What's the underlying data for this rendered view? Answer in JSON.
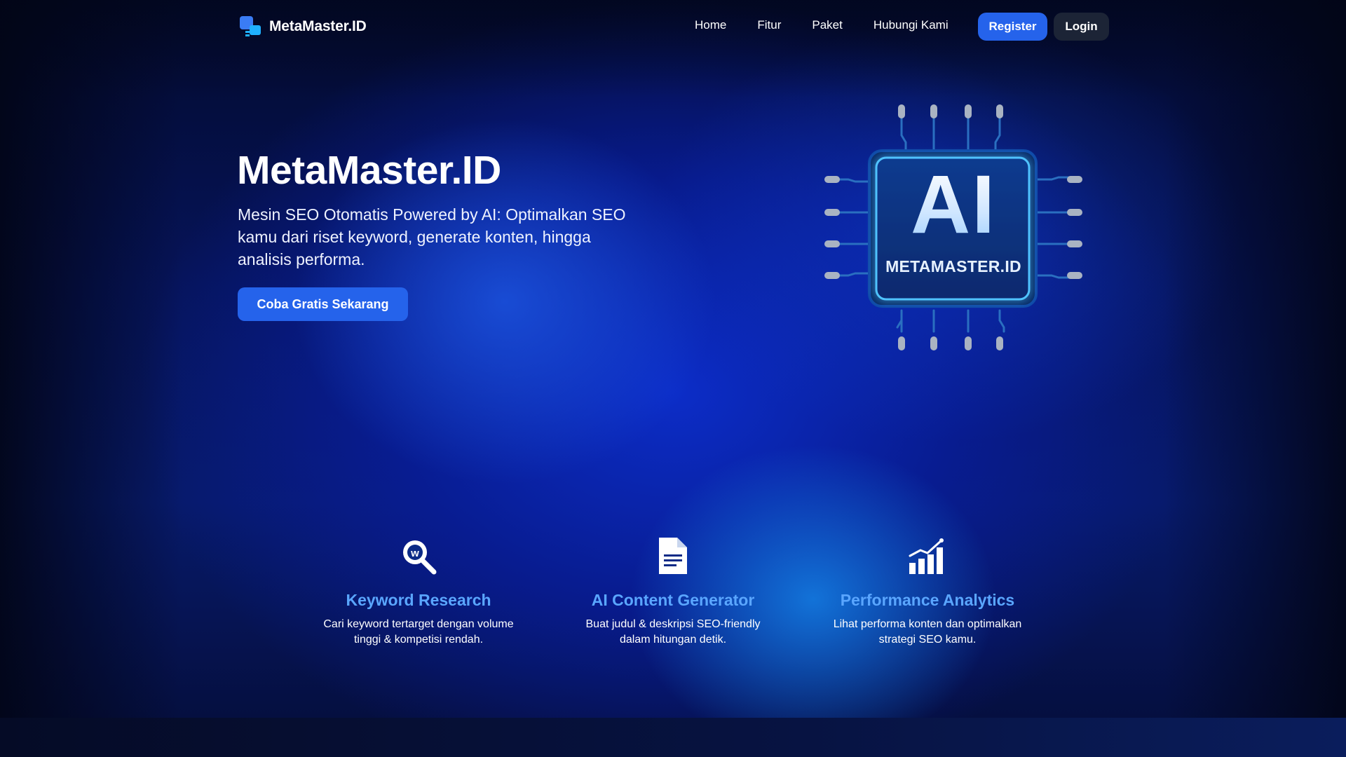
{
  "brand": {
    "name": "MetaMaster.ID"
  },
  "nav": {
    "links": [
      "Home",
      "Fitur",
      "Paket",
      "Hubungi Kami"
    ],
    "register_label": "Register",
    "login_label": "Login"
  },
  "hero": {
    "title": "MetaMaster.ID",
    "subtitle": "Mesin SEO Otomatis Powered by AI: Optimalkan SEO kamu dari riset keyword, generate konten, hingga analisis performa.",
    "cta_label": "Coba Gratis Sekarang",
    "chip_text": "AI",
    "chip_label": "METAMASTER.ID"
  },
  "features": [
    {
      "icon": "keyword-search-icon",
      "title": "Keyword Research",
      "desc": "Cari keyword tertarget dengan volume tinggi & kompetisi rendah."
    },
    {
      "icon": "document-icon",
      "title": "AI Content Generator",
      "desc": "Buat judul & deskripsi SEO-friendly dalam hitungan detik."
    },
    {
      "icon": "bar-chart-icon",
      "title": "Performance Analytics",
      "desc": "Lihat performa konten dan optimalkan strategi SEO kamu."
    }
  ],
  "colors": {
    "accent": "#2563eb",
    "feature_title": "#5aa6ff",
    "login_bg": "#1c2436"
  }
}
